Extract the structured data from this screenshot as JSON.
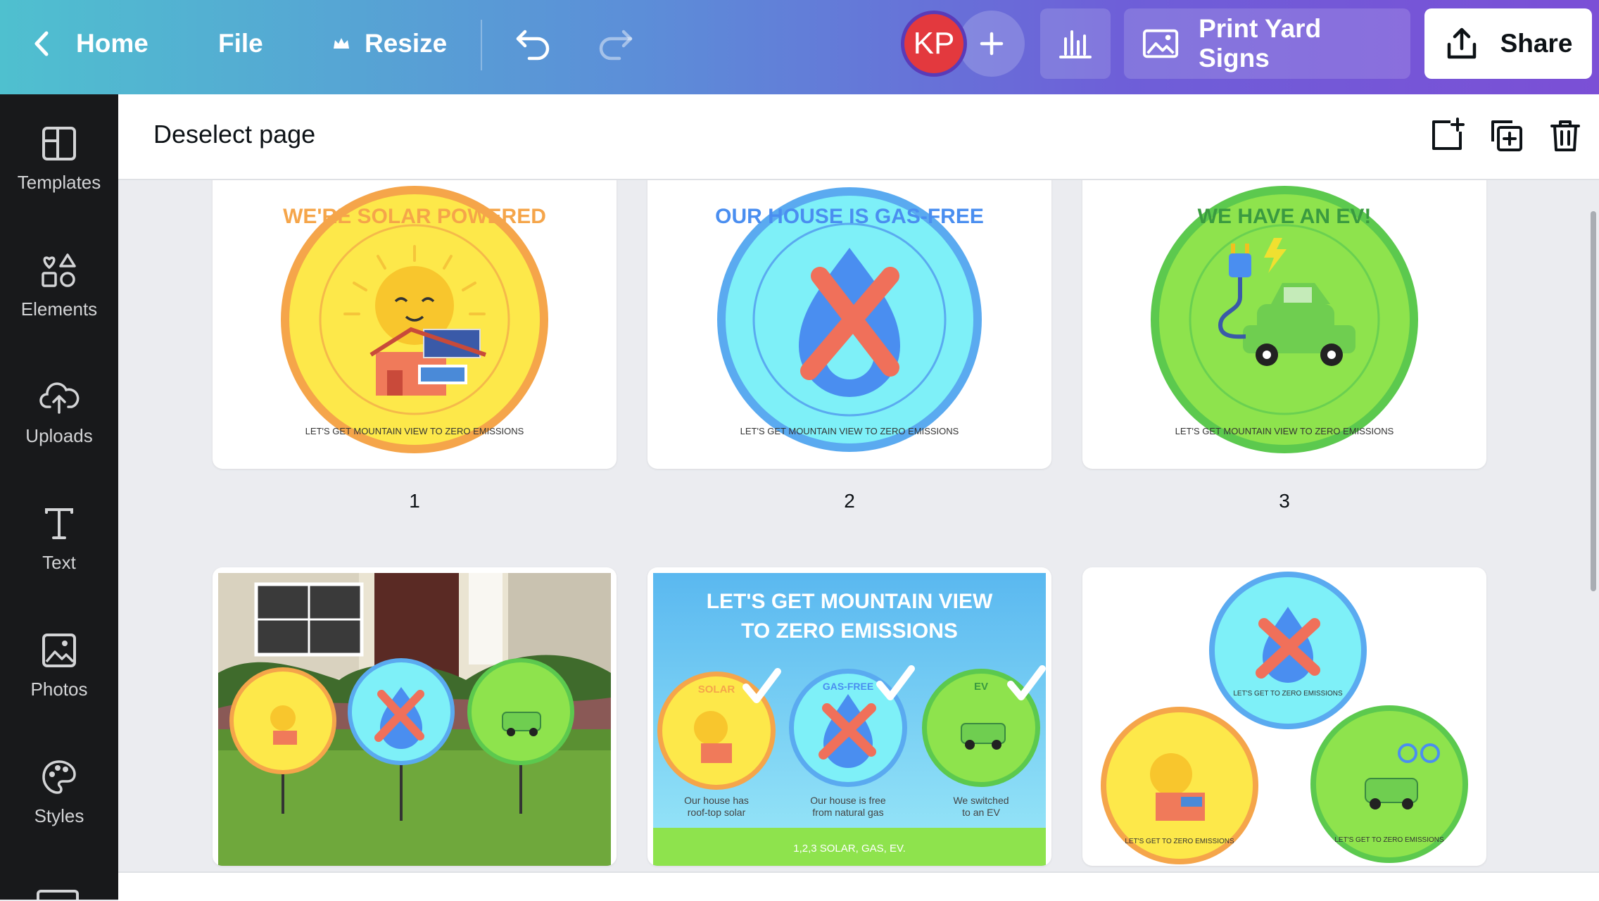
{
  "topbar": {
    "home_label": "Home",
    "file_label": "File",
    "resize_label": "Resize",
    "avatar_initials": "KP",
    "print_label": "Print Yard Signs",
    "share_label": "Share"
  },
  "sidebar": {
    "items": [
      {
        "label": "Templates",
        "icon": "templates-icon"
      },
      {
        "label": "Elements",
        "icon": "elements-icon"
      },
      {
        "label": "Uploads",
        "icon": "uploads-icon"
      },
      {
        "label": "Text",
        "icon": "text-icon"
      },
      {
        "label": "Photos",
        "icon": "photos-icon"
      },
      {
        "label": "Styles",
        "icon": "styles-icon"
      }
    ]
  },
  "pagebar": {
    "deselect_label": "Deselect page"
  },
  "pages": [
    {
      "number": "1",
      "title": "WE'RE SOLAR POWERED",
      "footer": "LET'S GET MOUNTAIN VIEW TO ZERO EMISSIONS"
    },
    {
      "number": "2",
      "title": "OUR HOUSE IS GAS-FREE",
      "footer": "LET'S GET MOUNTAIN VIEW TO ZERO EMISSIONS"
    },
    {
      "number": "3",
      "title": "WE HAVE AN EV!",
      "footer": "LET'S GET MOUNTAIN VIEW TO ZERO EMISSIONS"
    }
  ],
  "page5": {
    "heading_1": "LET'S GET MOUNTAIN VIEW",
    "heading_2": "TO ZERO EMISSIONS",
    "badge_solar": "SOLAR",
    "badge_gas": "GAS-FREE",
    "badge_ev": "EV",
    "caption_solar_1": "Our house has",
    "caption_solar_2": "roof-top solar",
    "caption_gas_1": "Our house is free",
    "caption_gas_2": "from natural gas",
    "caption_ev_1": "We switched",
    "caption_ev_2": "to an EV",
    "footer": "1,2,3 SOLAR, GAS, EV."
  },
  "page6": {
    "footer": "LET'S GET TO ZERO EMISSIONS"
  },
  "colors": {
    "solar_yellow": "#fde84a",
    "solar_orange": "#f5a54a",
    "gas_blue": "#7ef0f8",
    "gas_ring": "#5aaaf0",
    "ev_green": "#8ee34d",
    "ev_ring": "#5cc94e",
    "cross_red": "#f0705a"
  }
}
